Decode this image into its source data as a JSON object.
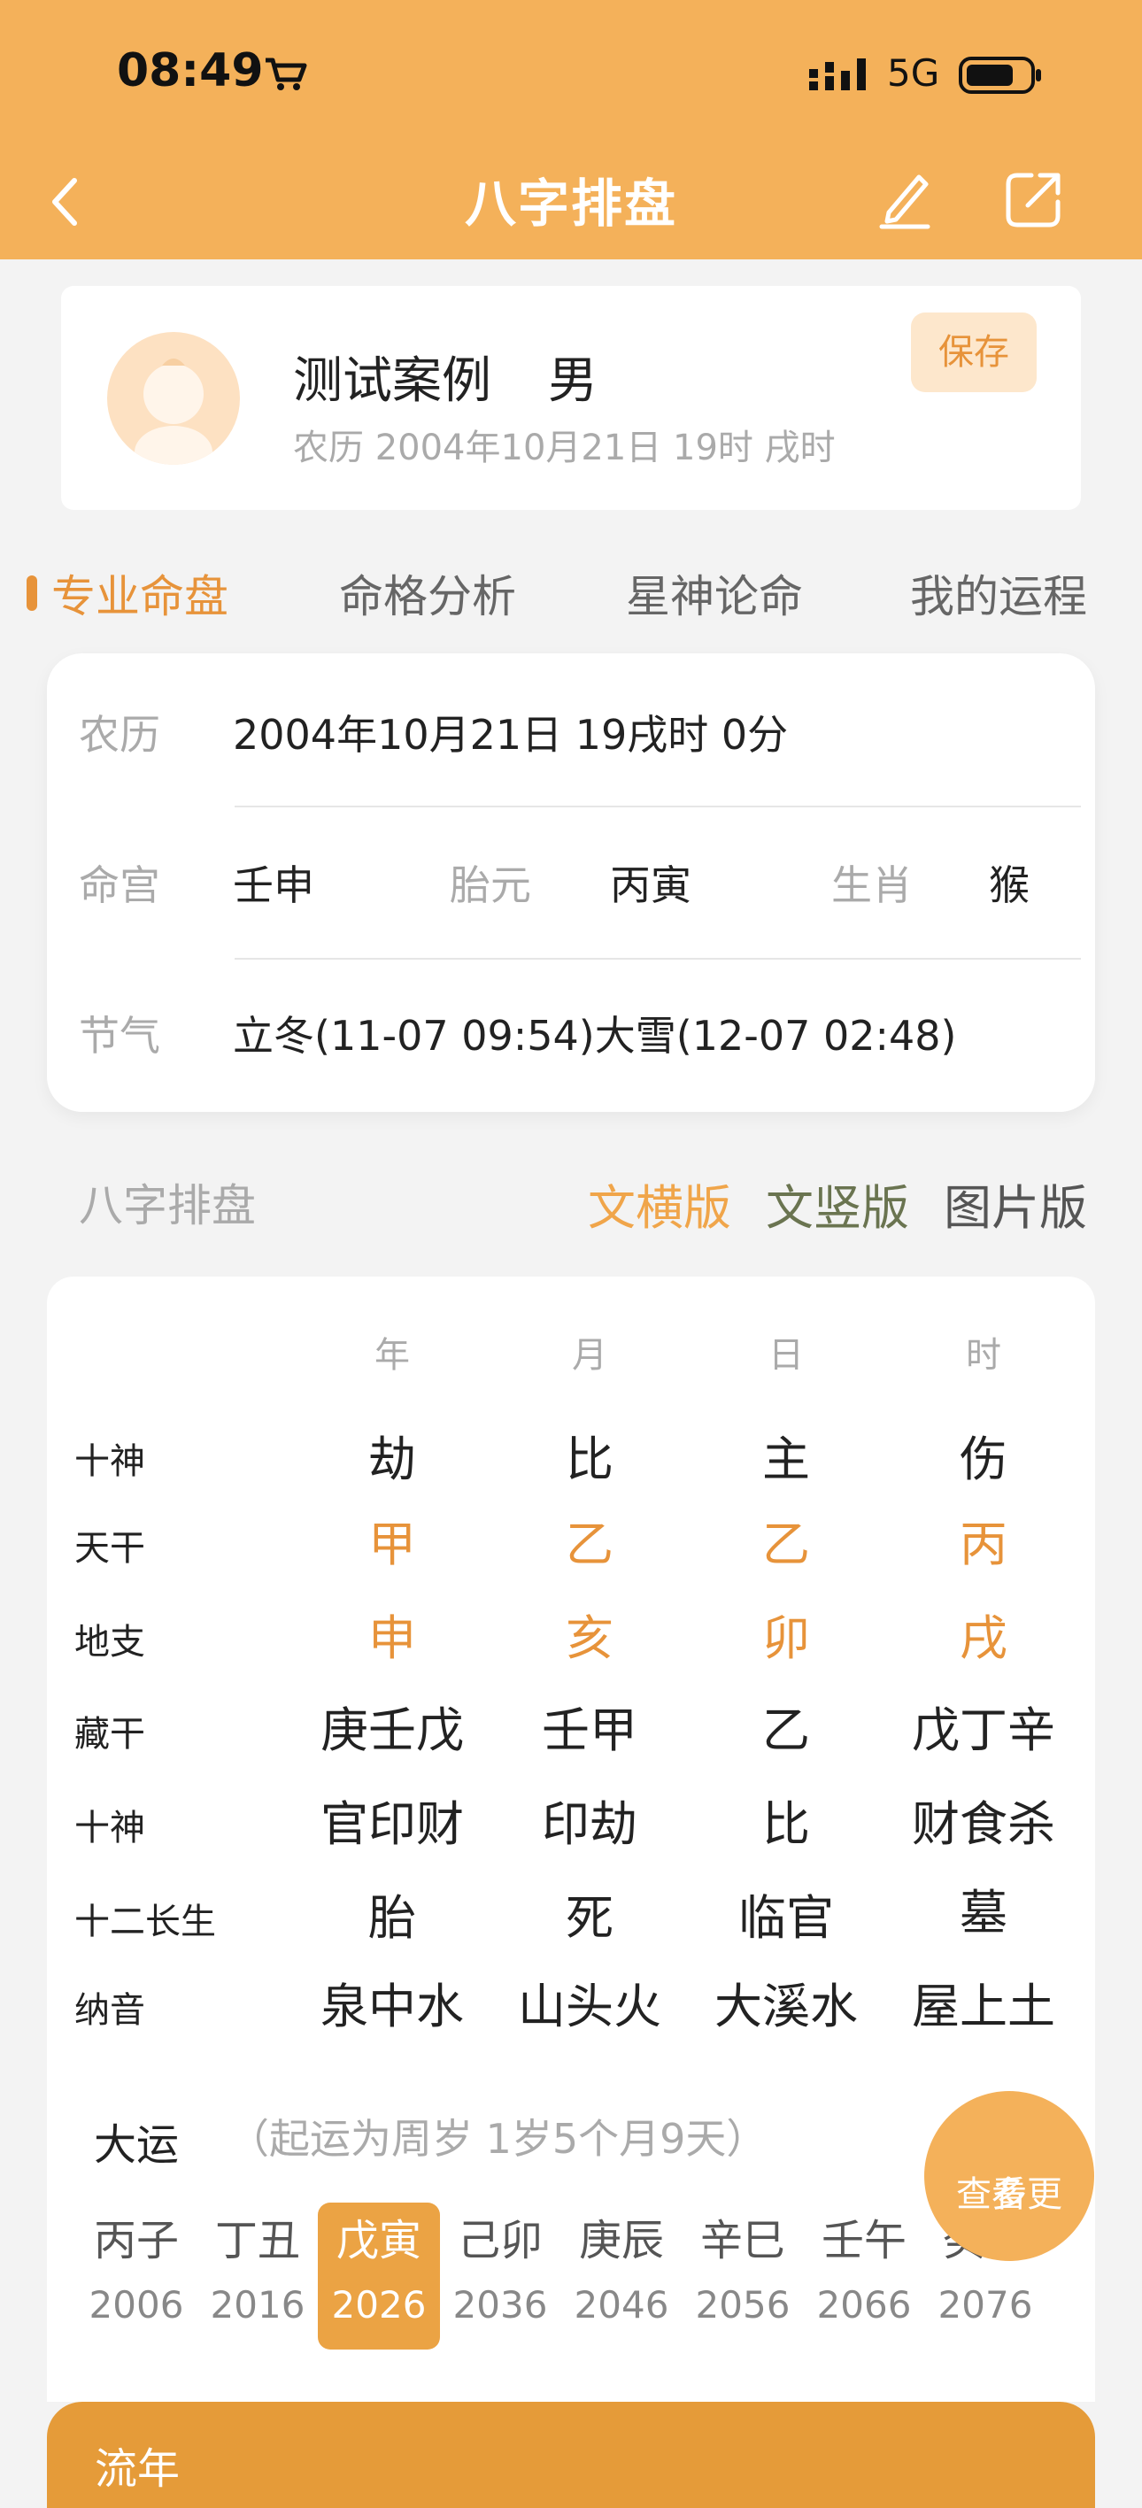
{
  "status_bar": {
    "time": "08:49",
    "network": "5G"
  },
  "header": {
    "title": "八字排盘"
  },
  "profile": {
    "name": "测试案例",
    "gender": "男",
    "date": "农历 2004年10月21日 19时 戌时",
    "save_label": "保存"
  },
  "tabs": [
    "专业命盘",
    "命格分析",
    "星神论命",
    "我的运程"
  ],
  "info": {
    "lunar_label": "农历",
    "lunar_value": "2004年10月21日 19戌时 0分",
    "minggong_label": "命宫",
    "minggong_value": "壬申",
    "taiyuan_label": "胎元",
    "taiyuan_value": "丙寅",
    "shengxiao_label": "生肖",
    "shengxiao_value": "猴",
    "jieqi_label": "节气",
    "jieqi_value": "立冬(11-07 09:54)大雪(12-07 02:48)"
  },
  "section": {
    "title": "八字排盘",
    "views": [
      "文横版",
      "文竖版",
      "图片版"
    ]
  },
  "bazi": {
    "columns": [
      "年",
      "月",
      "日",
      "时"
    ],
    "rows": [
      {
        "label": "十神",
        "cells": [
          "劫",
          "比",
          "主",
          "伤"
        ]
      },
      {
        "label": "天干",
        "cells": [
          "甲",
          "乙",
          "乙",
          "丙"
        ]
      },
      {
        "label": "地支",
        "cells": [
          "申",
          "亥",
          "卯",
          "戌"
        ]
      },
      {
        "label": "藏干",
        "cells": [
          "庚壬戊",
          "壬甲",
          "乙",
          "戊丁辛"
        ]
      },
      {
        "label": "十神",
        "cells": [
          "官印财",
          "印劫",
          "比",
          "财食杀"
        ]
      },
      {
        "label": "十二长生",
        "cells": [
          "胎",
          "死",
          "临官",
          "墓"
        ]
      },
      {
        "label": "纳音",
        "cells": [
          "泉中水",
          "山头火",
          "大溪水",
          "屋上土"
        ]
      }
    ]
  },
  "dayun": {
    "title": "大运",
    "note": "（起运为周岁 1岁5个月9天）",
    "more_label_1": "查看更",
    "more_label_2": "多",
    "items": [
      {
        "gz": "丙子",
        "year": "2006"
      },
      {
        "gz": "丁丑",
        "year": "2016"
      },
      {
        "gz": "戊寅",
        "year": "2026"
      },
      {
        "gz": "己卯",
        "year": "2036"
      },
      {
        "gz": "庚辰",
        "year": "2046"
      },
      {
        "gz": "辛巳",
        "year": "2056"
      },
      {
        "gz": "壬午",
        "year": "2066"
      },
      {
        "gz": "癸未",
        "year": "2076"
      }
    ]
  },
  "liunian": {
    "title": "流年"
  },
  "colors": {
    "header": "#f4b15a",
    "accent": "#e7933a",
    "green_option": "#6a7450"
  }
}
